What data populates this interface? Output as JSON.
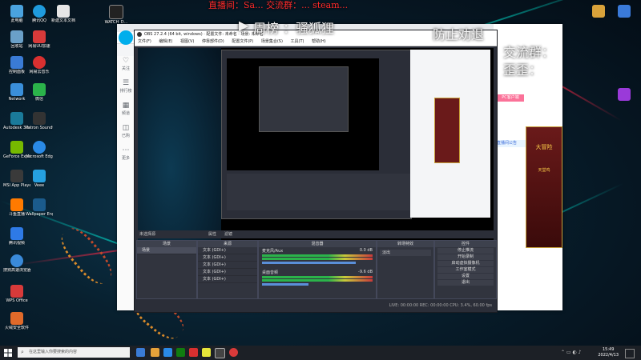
{
  "overlay": {
    "top_text": "直播间：Sa... 交流群：... steam...",
    "line1_left": "▶",
    "line1": "周榜 ：骚狐狸",
    "line1_right": "防止劝退",
    "line2_label": "交流群：",
    "line3": "歪歪："
  },
  "desktop_icons": [
    {
      "label": "此电脑",
      "color": "#4aa3df"
    },
    {
      "label": "腾讯QQ",
      "color": "#1f9bde"
    },
    {
      "label": "新建文本文档",
      "color": "#e6e6e6"
    },
    {
      "label": "WATCH_D...",
      "color": "#222222"
    },
    {
      "label": "回收站",
      "color": "#6aa0c8"
    },
    {
      "label": "网易UU加速",
      "color": "#d83a3a"
    },
    {
      "label": "控制面板",
      "color": "#3a7bd5"
    },
    {
      "label": "网易云音乐",
      "color": "#d93030"
    },
    {
      "label": "Network",
      "color": "#3a8fd9"
    },
    {
      "label": "微信",
      "color": "#2bb34a"
    },
    {
      "label": "Autodesk 3ds Max",
      "color": "#1a7a9a"
    },
    {
      "label": "Patron Soundtrack",
      "color": "#333333"
    },
    {
      "label": "GeForce Experience",
      "color": "#76b900"
    },
    {
      "label": "Microsoft Edge",
      "color": "#2a8ae6"
    },
    {
      "label": "MSI App Player",
      "color": "#3a3a3a"
    },
    {
      "label": "Veee",
      "color": "#25a0e0"
    },
    {
      "label": "斗鱼直播",
      "color": "#ff7a00"
    },
    {
      "label": "Wallpaper Engine",
      "color": "#1b5b8c"
    },
    {
      "label": "腾讯视频",
      "color": "#2e7ae6"
    },
    {
      "label": "搜狗高速浏览器",
      "color": "#3a8ad9"
    },
    {
      "label": "WPS Office",
      "color": "#d83a3a"
    },
    {
      "label": "火绒安全软件",
      "color": "#e06a2a"
    }
  ],
  "obs": {
    "title": "OBS 27.2.4 (64 bit, windows) · 配置文件: 未命名 · 场景: 未命名",
    "menu": [
      "文件(F)",
      "编辑(E)",
      "视图(V)",
      "停靠部件(D)",
      "配置文件(P)",
      "场景集合(S)",
      "工具(T)",
      "帮助(H)"
    ],
    "no_source_label": "未选择源",
    "toolbar_labels": [
      "属性",
      "滤镜"
    ],
    "docks": {
      "scenes": "场景",
      "sources": "来源",
      "mixer": "混音器",
      "transitions": "转场特效",
      "controls": "控件"
    },
    "scene_items": [
      "场景"
    ],
    "source_items": [
      "文本 (GDI+)",
      "文本 (GDI+)",
      "文本 (GDI+)",
      "文本 (GDI+)",
      "文本 (GDI+)"
    ],
    "mixer_items": [
      {
        "name": "麦克风/Aux",
        "db": "0.0 dB"
      },
      {
        "name": "桌面音频",
        "db": "-9.6 dB"
      }
    ],
    "transition_value": "淡出",
    "controls": [
      "停止推流",
      "开始录制",
      "启动虚拟摄像机",
      "工作室模式",
      "设置",
      "退出"
    ],
    "status": "LIVE: 00:00:00   REC: 00:00:00   CPU: 3.4%, 60.00 fps"
  },
  "browser": {
    "sidebar_items": [
      "关注",
      "排行榜",
      "频道",
      "已购",
      "更多"
    ],
    "right_panel": {
      "title": "天堂鸡",
      "notice": "直播间公告",
      "gift_text": "大冒险",
      "btn": "PC客户端"
    }
  },
  "taskbar": {
    "search_placeholder": "在这里输入你要搜索的内容",
    "time": "15:49",
    "date": "2022/4/13"
  }
}
